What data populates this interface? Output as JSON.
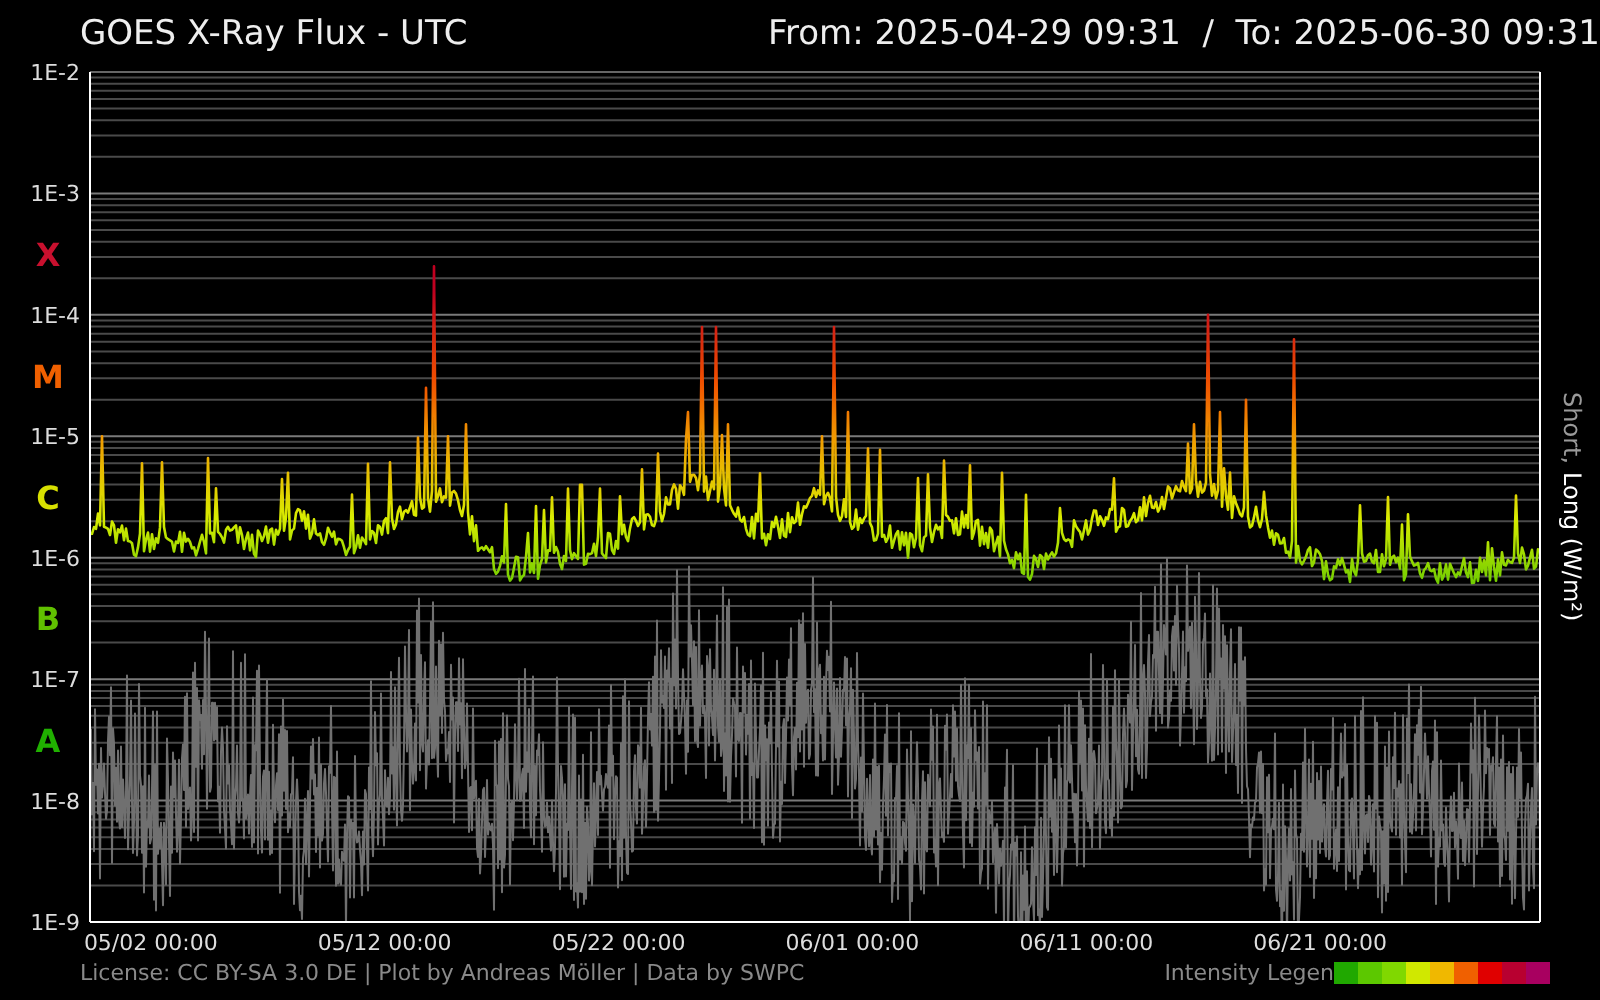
{
  "header": {
    "title": "GOES X-Ray Flux - UTC",
    "range": "From: 2025-04-29 09:31  /  To: 2025-06-30 09:31"
  },
  "flare_classes": [
    {
      "label": "X",
      "color": "#c8102e"
    },
    {
      "label": "M",
      "color": "#f06000"
    },
    {
      "label": "C",
      "color": "#d8e000"
    },
    {
      "label": "B",
      "color": "#60c000"
    },
    {
      "label": "A",
      "color": "#20b000"
    }
  ],
  "plot": {
    "y_ticks": [
      "1E-2",
      "1E-3",
      "1E-4",
      "1E-5",
      "1E-6",
      "1E-7",
      "1E-8",
      "1E-9"
    ],
    "x_ticks": [
      "05/02 00:00",
      "05/12 00:00",
      "05/22 00:00",
      "06/01 00:00",
      "06/11 00:00",
      "06/21 00:00"
    ],
    "axis_title": [
      {
        "text": "Short,",
        "color": "#9a9a9a"
      },
      {
        "text": "Long (W/m²)",
        "color": "#ffffff"
      }
    ]
  },
  "footer": {
    "license": "License: CC BY-SA 3.0 DE | Plot by Andreas Möller | Data by SWPC",
    "legend": {
      "label": "Intensity Legen",
      "swatches": [
        {
          "color": "#20a800"
        },
        {
          "color": "#5cc800"
        },
        {
          "color": "#80d800"
        },
        {
          "color": "#d0e800"
        },
        {
          "color": "#f0b800"
        },
        {
          "color": "#f06000"
        },
        {
          "color": "#e00000"
        },
        {
          "color": "#b80030"
        },
        {
          "color": "#a80060"
        }
      ]
    }
  }
}
